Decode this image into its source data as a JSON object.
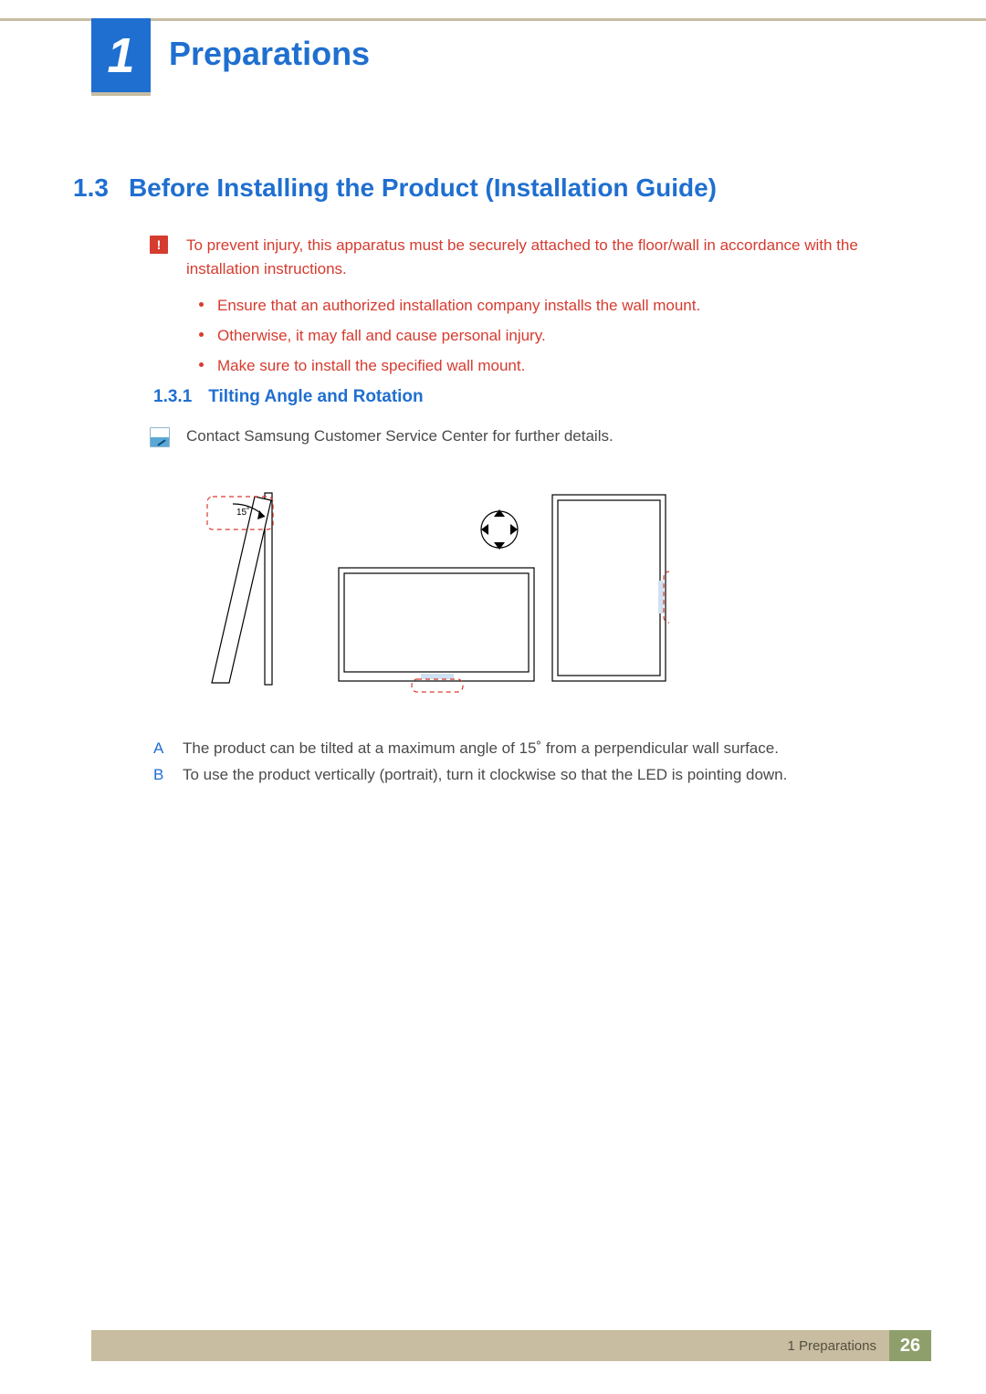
{
  "header": {
    "chapter_number": "1",
    "chapter_title": "Preparations"
  },
  "section": {
    "number": "1.3",
    "title": "Before Installing the Product (Installation Guide)"
  },
  "warning": {
    "lead": "To prevent injury, this apparatus must be securely attached to the floor/wall in accordance with the installation instructions.",
    "bullets": [
      "Ensure that an authorized installation company installs the wall mount.",
      "Otherwise, it may fall and cause personal injury.",
      "Make sure to install the specified wall mount."
    ]
  },
  "subsection": {
    "number": "1.3.1",
    "title": "Tilting Angle and Rotation"
  },
  "note": {
    "text": "Contact Samsung Customer Service Center for further details."
  },
  "figure": {
    "tilt_label": "15˚"
  },
  "items": [
    {
      "key": "A",
      "text": "The product can be tilted at a maximum angle of 15˚ from a perpendicular wall surface."
    },
    {
      "key": "B",
      "text": "To use the product vertically (portrait), turn it clockwise so that the LED is pointing down."
    }
  ],
  "footer": {
    "label": "1 Preparations",
    "page": "26"
  }
}
